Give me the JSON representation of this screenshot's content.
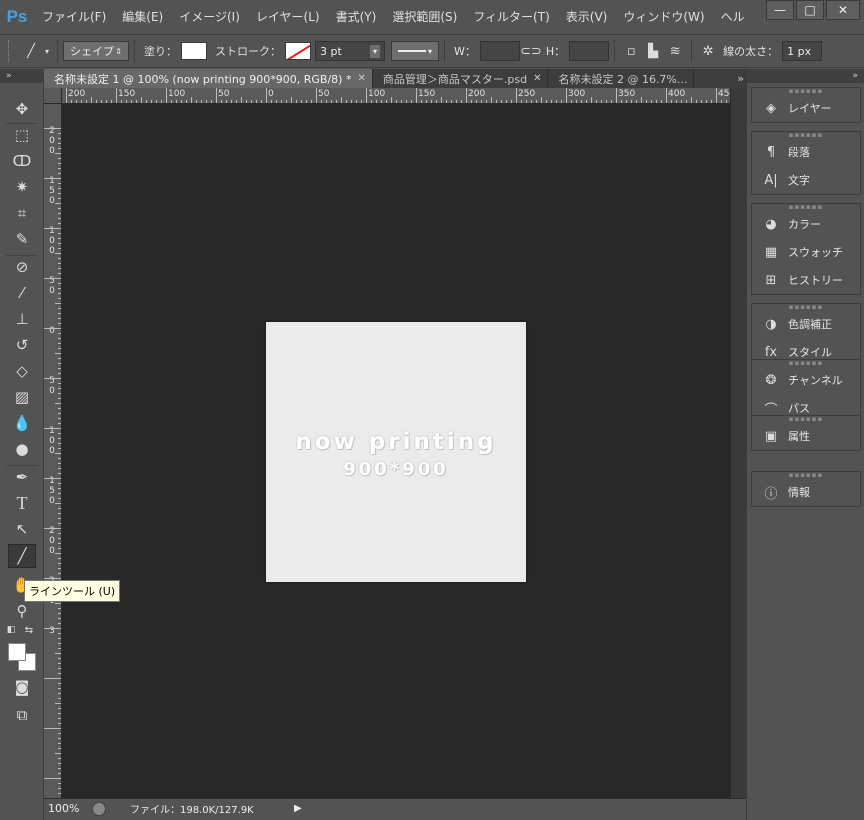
{
  "app": {
    "logo": "Ps"
  },
  "menu": [
    "ファイル(F)",
    "編集(E)",
    "イメージ(I)",
    "レイヤー(L)",
    "書式(Y)",
    "選択範囲(S)",
    "フィルター(T)",
    "表示(V)",
    "ウィンドウ(W)",
    "ヘル"
  ],
  "window_controls": {
    "minimize": "—",
    "maximize": "□",
    "close": "✕"
  },
  "options": {
    "mode": "シェイプ",
    "fill_label": "塗り：",
    "stroke_label": "ストローク：",
    "stroke_width": "3 pt",
    "w_label": "W：",
    "h_label": "H：",
    "weight_label": "線の太さ：",
    "weight_value": "1 px"
  },
  "tabs": [
    {
      "label": "名称未設定 1 @ 100% (now printing 900*900, RGB/8) *",
      "active": true
    },
    {
      "label": "商品管理＞商品マスター.psd",
      "active": false
    },
    {
      "label": "名称未設定 2 @ 16.7%...",
      "active": false
    }
  ],
  "tab_overflow": "»",
  "ruler_top": [
    "200",
    "150",
    "100",
    "50",
    "0",
    "50",
    "100",
    "150",
    "200",
    "250",
    "300",
    "350",
    "400",
    "45"
  ],
  "ruler_left": [
    "2\n0\n0",
    "1\n5\n0",
    "1\n0\n0",
    "5\n0",
    "0",
    "5\n0",
    "1\n0\n0",
    "1\n5\n0",
    "2\n0\n0",
    "2\n5\n0",
    "3"
  ],
  "image": {
    "line1": "now printing",
    "line2": "900*900"
  },
  "tooltip": "ラインツール (U)",
  "status": {
    "zoom": "100%",
    "file_info": "ファイル：198.0K/127.9K",
    "arrow": "▶"
  },
  "panels": [
    [
      {
        "icon": "layers-icon",
        "glyph": "◈",
        "label": "レイヤー"
      }
    ],
    [
      {
        "icon": "paragraph-icon",
        "glyph": "¶",
        "label": "段落"
      },
      {
        "icon": "character-icon",
        "glyph": "A|",
        "label": "文字"
      }
    ],
    [
      {
        "icon": "color-icon",
        "glyph": "◕",
        "label": "カラー"
      },
      {
        "icon": "swatches-icon",
        "glyph": "▦",
        "label": "スウォッチ"
      },
      {
        "icon": "history-icon",
        "glyph": "⊞",
        "label": "ヒストリー"
      }
    ],
    [
      {
        "icon": "adjustments-icon",
        "glyph": "◑",
        "label": "色調補正"
      },
      {
        "icon": "styles-icon",
        "glyph": "fx",
        "label": "スタイル"
      }
    ],
    [
      {
        "icon": "channels-icon",
        "glyph": "❂",
        "label": "チャンネル"
      },
      {
        "icon": "paths-icon",
        "glyph": "⌒",
        "label": "パス"
      }
    ],
    [
      {
        "icon": "properties-icon",
        "glyph": "▣",
        "label": "属性"
      }
    ],
    [
      {
        "icon": "info-icon",
        "glyph": "ⓘ",
        "label": "情報"
      }
    ]
  ]
}
